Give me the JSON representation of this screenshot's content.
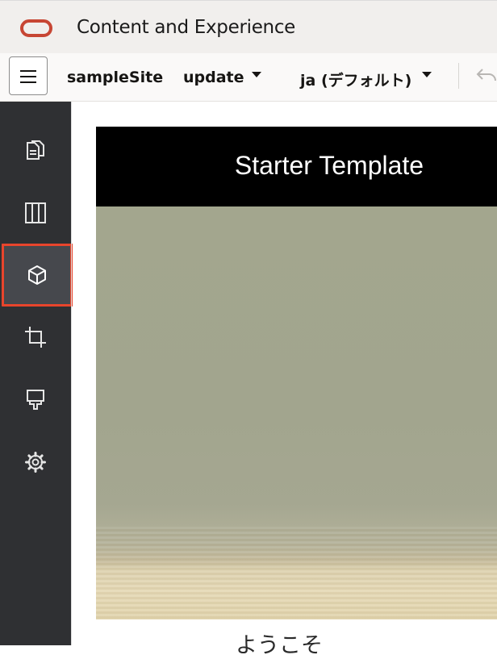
{
  "header": {
    "app_title": "Content and Experience",
    "logo_icon": "oracle-logo-icon",
    "logo_color": "#c74634"
  },
  "toolbar": {
    "menu_icon": "hamburger-menu-icon",
    "site_name": "sampleSite",
    "update_selector": "update",
    "language_selector": "ja (デフォルト)",
    "undo_icon": "undo-icon"
  },
  "rail": {
    "items": [
      {
        "name": "pages",
        "icon": "pages-icon"
      },
      {
        "name": "layout",
        "icon": "columns-icon"
      },
      {
        "name": "components",
        "icon": "cube-icon",
        "active": true
      },
      {
        "name": "crop",
        "icon": "crop-icon"
      },
      {
        "name": "theme",
        "icon": "paint-brush-icon"
      },
      {
        "name": "settings",
        "icon": "gear-icon"
      }
    ],
    "active_highlight_color": "#e8452c"
  },
  "canvas": {
    "banner_title": "Starter Template",
    "welcome_text": "ようこそ"
  }
}
